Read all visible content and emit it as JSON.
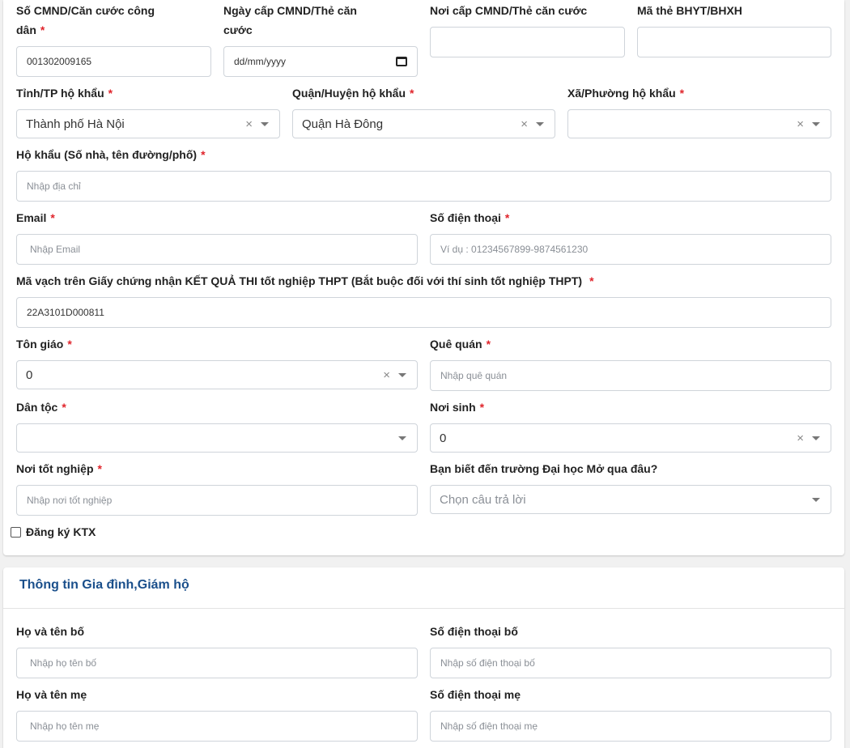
{
  "personal": {
    "cmnd_label": "Số CMND/Căn cước công",
    "cmnd_label_2": "dân",
    "cmnd_value": "001302009165",
    "issue_date_label": "Ngày cấp CMND/Thẻ căn",
    "issue_date_label_2": "cước",
    "issue_date_placeholder": "dd/mm/yyyy",
    "issue_place_label": "Nơi cấp CMND/Thẻ căn cước",
    "issue_place_value": "",
    "insurance_label": "Mã thẻ BHYT/BHXH",
    "insurance_value": "",
    "province_label": "Tỉnh/TP hộ khẩu",
    "province_value": "Thành phố Hà Nội",
    "district_label": "Quận/Huyện hộ khẩu",
    "district_value": "Quận Hà Đông",
    "ward_label": "Xã/Phường hộ khẩu",
    "ward_value": "",
    "address_label": "Hộ khẩu (Số nhà, tên đường/phố)",
    "address_placeholder": "Nhập địa chỉ",
    "email_label": "Email",
    "email_placeholder": "Nhập Email",
    "phone_label": "Số điện thoại",
    "phone_placeholder": "Ví dụ : 01234567899-9874561230",
    "barcode_label": "Mã vạch trên Giấy chứng nhận KẾT QUẢ THI tốt nghiệp THPT (Bắt buộc đối với thí sinh tốt nghiệp THPT)",
    "barcode_value": "22A3101D000811",
    "religion_label": "Tôn giáo",
    "religion_value": "0",
    "hometown_label": "Quê quán",
    "hometown_placeholder": "Nhập quê quán",
    "ethnicity_label": "Dân tộc",
    "ethnicity_value": "",
    "birthplace_label": "Nơi sinh",
    "birthplace_value": "0",
    "grad_place_label": "Nơi tốt nghiệp",
    "grad_place_placeholder": "Nhập nơi tốt nghiệp",
    "source_label": "Bạn biết đến trường Đại học Mở qua đâu?",
    "source_placeholder": "Chọn câu trả lời",
    "dorm_label": "Đăng ký KTX",
    "required_mark": "*",
    "clear_glyph": "×"
  },
  "family": {
    "section_title": "Thông tin Gia đình,Giám hộ",
    "father_name_label": "Họ và tên bố",
    "father_name_placeholder": "Nhập họ tên bố",
    "father_phone_label": "Số điện thoại bố",
    "father_phone_placeholder": "Nhập số điện thoại bố",
    "mother_name_label": "Họ và tên mẹ",
    "mother_name_placeholder": "Nhập họ tên mẹ",
    "mother_phone_label": "Số điện thoại mẹ",
    "mother_phone_placeholder": "Nhập số điện thoại mẹ"
  }
}
